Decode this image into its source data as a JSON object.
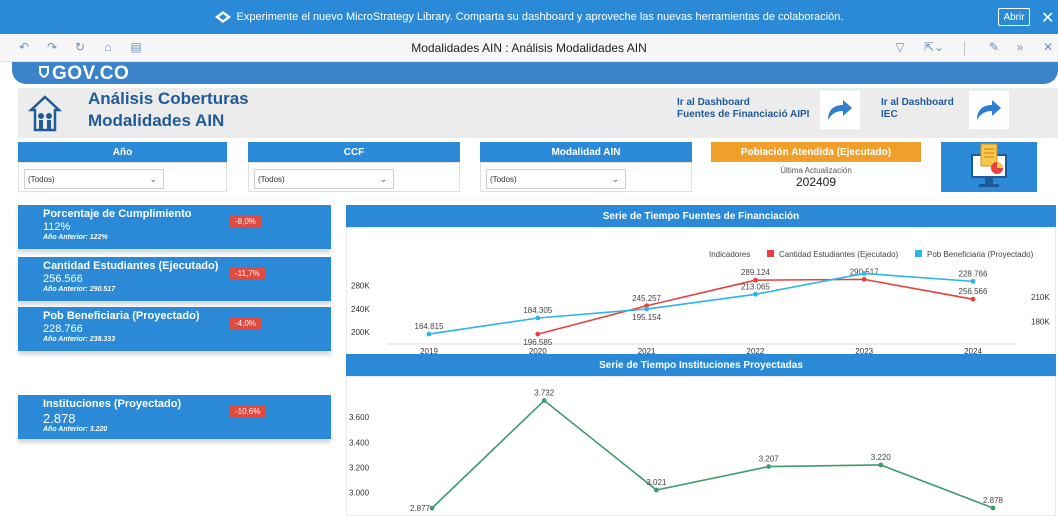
{
  "banner": {
    "text": "Experimente el nuevo MicroStrategy Library. Comparta su dashboard y aproveche las nuevas herramientas de colaboración.",
    "open_label": "Abrir",
    "close_icon": "close-icon"
  },
  "toolbar": {
    "title": "Modalidades AIN : Análisis Modalidades AIN",
    "icons": [
      "back-icon",
      "forward-icon",
      "refresh-icon",
      "home-icon",
      "document-icon",
      "filter-icon",
      "share-icon",
      "edit-icon",
      "collapse-icon",
      "close-icon"
    ]
  },
  "gov": {
    "text": "GOV.CO"
  },
  "header": {
    "title_line1": "Análisis Coberturas",
    "title_line2": "Modalidades AIN",
    "link1_line1": "Ir al Dashboard",
    "link1_line2": "Fuentes de Financiació AIPI",
    "link2_line1": "Ir al Dashboard",
    "link2_line2": "IEC"
  },
  "filters": [
    {
      "label": "Año",
      "value": "(Todos)"
    },
    {
      "label": "CCF",
      "value": "(Todos)"
    },
    {
      "label": "Modalidad AIN",
      "value": "(Todos)"
    }
  ],
  "population": {
    "label": "Población Atendida (Ejecutado)",
    "update_label": "Última Actualización",
    "update_value": "202409"
  },
  "kpis": [
    {
      "title": "Porcentaje de Cumplimiento",
      "value": "112%",
      "prev": "Año Anterior: 122%",
      "badge": "-8,0%"
    },
    {
      "title": "Cantidad Estudiantes (Ejecutado)",
      "value": "256.566",
      "prev": "Año Anterior: 290.517",
      "badge": "-11,7%"
    },
    {
      "title": "Pob Beneficiaria (Proyectado)",
      "value": "228.766",
      "prev": "Año Anterior: 238.333",
      "badge": "-4,0%"
    },
    {
      "title": "Instituciones (Proyectado)",
      "value": "2.878",
      "prev": "Año Anterior: 3.220",
      "badge": "-10,6%"
    }
  ],
  "colors": {
    "primary": "#2b8ad8",
    "orange": "#f0a02a",
    "red": "#e8413c",
    "cyan": "#29b6e8",
    "green": "#3e9b6b",
    "badge": "#e04a3f"
  },
  "chart_data": [
    {
      "type": "line",
      "title": "Serie de Tiempo Fuentes de Financiación",
      "legend_title": "Indicadores",
      "legend_position": "top-right",
      "x": [
        "2019",
        "2020",
        "2021",
        "2022",
        "2023",
        "2024"
      ],
      "series": [
        {
          "name": "Cantidad Estudiantes (Ejecutado)",
          "axis": "left",
          "values": [
            null,
            196585,
            245257,
            289124,
            290517,
            256566
          ],
          "labels": [
            "",
            "196.585",
            "245.257",
            "289.124",
            "290.517",
            "256.566"
          ]
        },
        {
          "name": "Pob Beneficiaria (Proyectado)",
          "axis": "right",
          "values": [
            164815,
            184305,
            195154,
            213065,
            238333,
            228766
          ],
          "labels": [
            "164.815",
            "184.305",
            "195.154",
            "213.065",
            "",
            "228.766"
          ]
        }
      ],
      "left_ticks": [
        "200K",
        "240K",
        "280K"
      ],
      "right_ticks": [
        "180K",
        "210K"
      ],
      "ylim_left": [
        190000,
        310000
      ],
      "ylim_right": [
        160000,
        245000
      ]
    },
    {
      "type": "line",
      "title": "Serie de Tiempo Instituciones Proyectadas",
      "x": [
        "2019",
        "2020",
        "2021",
        "2022",
        "2023",
        "2024"
      ],
      "series": [
        {
          "name": "",
          "values": [
            2877,
            3732,
            3021,
            3207,
            3220,
            2878
          ],
          "labels": [
            "2.877",
            "3.732",
            "3.021",
            "3.207",
            "3.220",
            "2.878"
          ]
        }
      ],
      "y_ticks": [
        "3.000",
        "3.200",
        "3.400",
        "3.600"
      ],
      "ylim": [
        2870,
        3760
      ]
    }
  ]
}
